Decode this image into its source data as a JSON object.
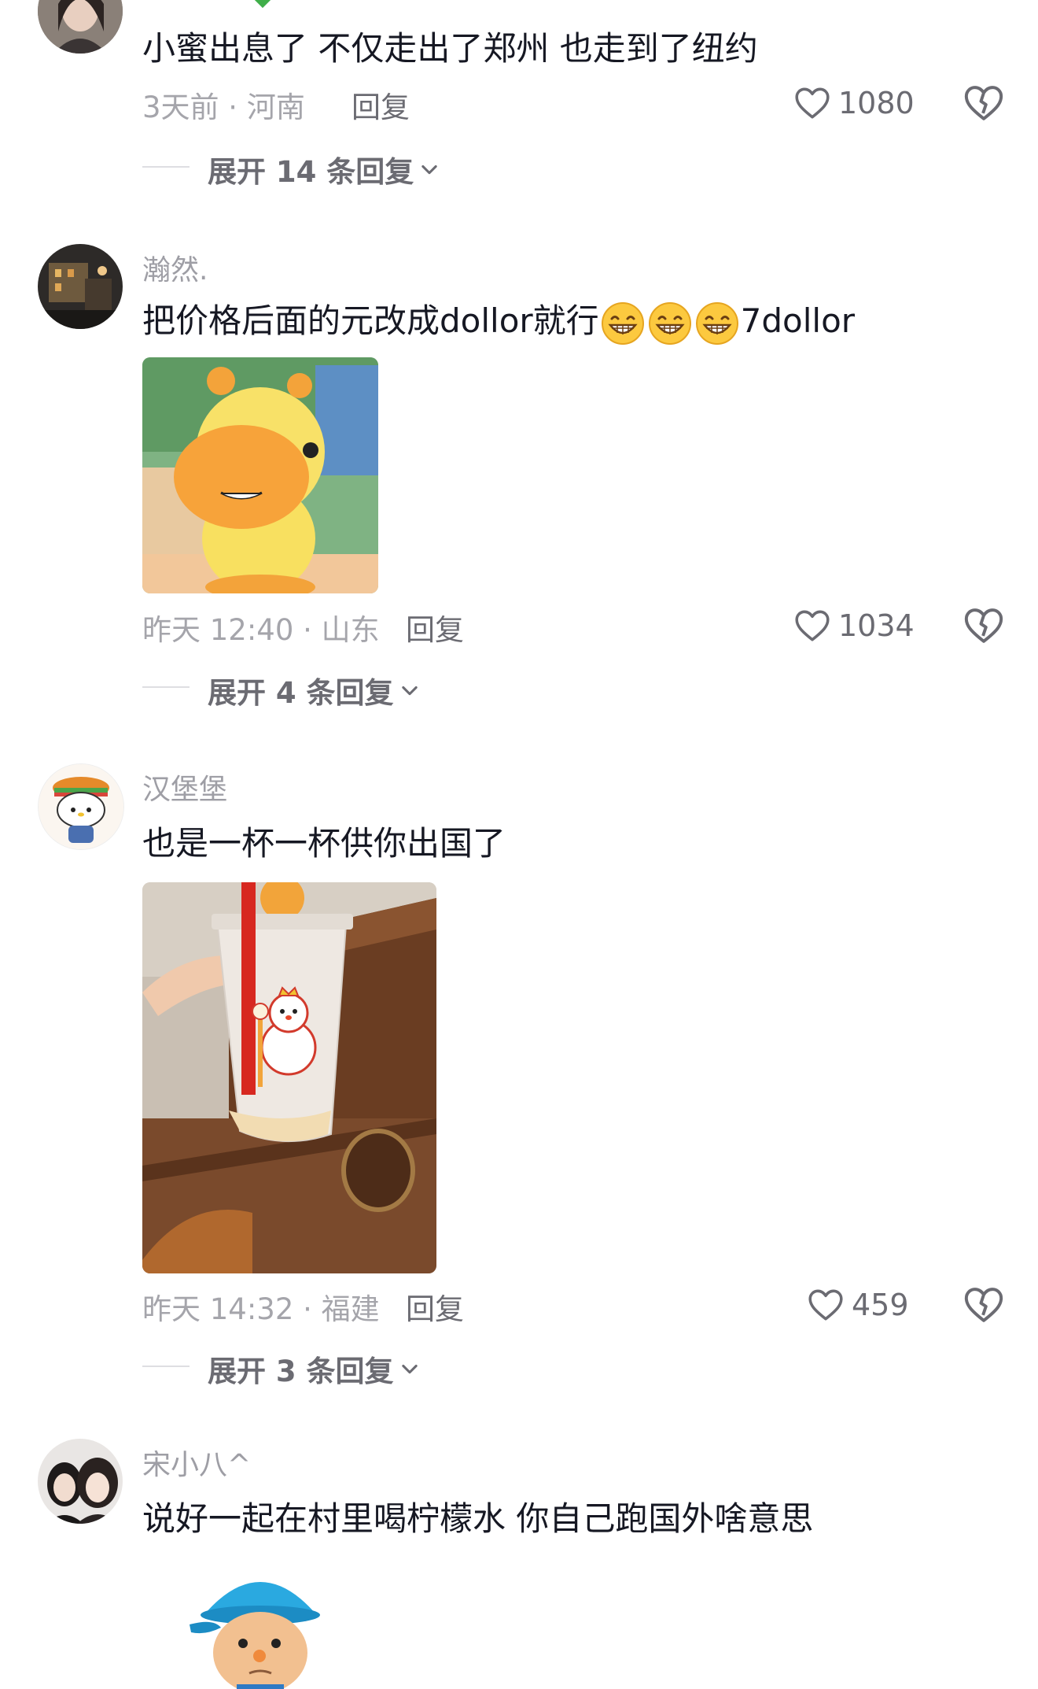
{
  "comments": [
    {
      "text": "小蜜出息了  不仅走出了郑州  也走到了纽约",
      "time": "3天前 · 河南",
      "reply": "回复",
      "likes": "1080",
      "expand": "展开 14 条回复"
    },
    {
      "username": "瀚然.",
      "text_part1": "把价格后面的元改成dollor就行",
      "text_part2": "7dollor",
      "emojis": [
        "grin-emoji",
        "grin-emoji",
        "grin-emoji"
      ],
      "time": "昨天 12:40 · 山东",
      "reply": "回复",
      "likes": "1034",
      "expand": "展开 4 条回复"
    },
    {
      "username": "汉堡堡",
      "text": "也是一杯一杯供你出国了",
      "time": "昨天 14:32 · 福建",
      "reply": "回复",
      "likes": "459",
      "expand": "展开 3 条回复"
    },
    {
      "username": "宋小八^",
      "text": "说好一起在村里喝柠檬水 你自己跑国外啥意思"
    }
  ],
  "colors": {
    "text": "#161823",
    "meta": "#a5a5ab",
    "action": "#6b6b72"
  }
}
